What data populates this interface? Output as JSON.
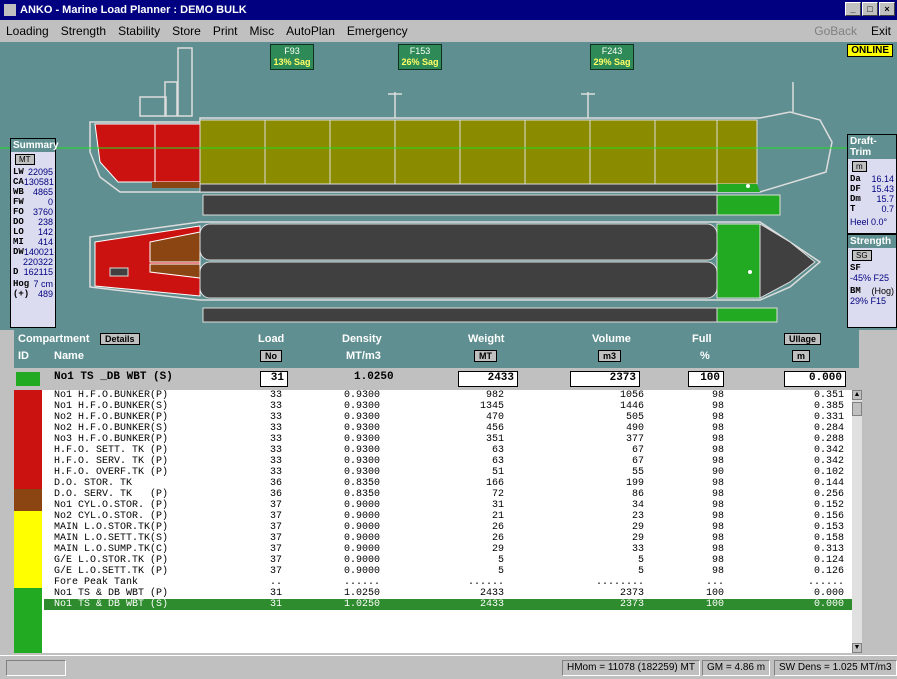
{
  "window": {
    "title": "ANKO - Marine Load Planner : DEMO BULK"
  },
  "menu": {
    "items": [
      "Loading",
      "Strength",
      "Stability",
      "Store",
      "Print",
      "Misc",
      "AutoPlan",
      "Emergency"
    ],
    "goback": "GoBack",
    "exit": "Exit"
  },
  "status_online": "ONLINE",
  "sag_frames": [
    {
      "frame": "F93",
      "value": "13% Sag"
    },
    {
      "frame": "F153",
      "value": "26% Sag"
    },
    {
      "frame": "F243",
      "value": "29% Sag"
    }
  ],
  "summary": {
    "title": "Summary",
    "unit": "MT",
    "rows": [
      [
        "LW",
        "22095"
      ],
      [
        "CA",
        "130581"
      ],
      [
        "WB",
        "4865"
      ],
      [
        "FW",
        "0"
      ],
      [
        "FO",
        "3760"
      ],
      [
        "DO",
        "238"
      ],
      [
        "LO",
        "142"
      ],
      [
        "MI",
        "414"
      ],
      [
        "DW",
        "140021"
      ],
      [
        "",
        "220322"
      ],
      [
        "D",
        "162115"
      ]
    ],
    "hog_label": "Hog",
    "hog_value": "7 cm",
    "hog_sign": "(+)",
    "hog_num": "489"
  },
  "draft_trim": {
    "title": "Draft-Trim",
    "unit": "m",
    "rows": [
      [
        "Da",
        "16.14"
      ],
      [
        "DF",
        "15.43"
      ],
      [
        "Dm",
        "15.7"
      ],
      [
        "T",
        "0.7"
      ]
    ],
    "heel": "Heel 0.0°"
  },
  "strength": {
    "title": "Strength",
    "unit": "SG",
    "sf_label": "SF",
    "sf_value": "-45% F25",
    "bm_label": "BM",
    "bm_mode": "(Hog)",
    "bm_value": "29% F15"
  },
  "table": {
    "headers": {
      "compartment": "Compartment",
      "details": "Details",
      "id": "ID",
      "name": "Name",
      "load": "Load",
      "load_unit": "No",
      "density": "Density",
      "density_unit": "MT/m3",
      "weight": "Weight",
      "weight_unit": "MT",
      "volume": "Volume",
      "volume_unit": "m3",
      "full": "Full",
      "full_unit": "%",
      "ullage": "Ullage",
      "ullage_unit": "m"
    },
    "selected": {
      "name": "No1 TS _DB WBT (S)",
      "load": "31",
      "density": "1.0250",
      "weight": "2433",
      "volume": "2373",
      "full": "100",
      "ullage": "0.000"
    },
    "rows": [
      [
        "No1 H.F.O.BUNKER(P)",
        "33",
        "0.9300",
        "982",
        "1056",
        "98",
        "0.351"
      ],
      [
        "No1 H.F.O.BUNKER(S)",
        "33",
        "0.9300",
        "1345",
        "1446",
        "98",
        "0.385"
      ],
      [
        "No2 H.F.O.BUNKER(P)",
        "33",
        "0.9300",
        "470",
        "505",
        "98",
        "0.331"
      ],
      [
        "No2 H.F.O.BUNKER(S)",
        "33",
        "0.9300",
        "456",
        "490",
        "98",
        "0.284"
      ],
      [
        "No3 H.F.O.BUNKER(P)",
        "33",
        "0.9300",
        "351",
        "377",
        "98",
        "0.288"
      ],
      [
        "H.F.O. SETT. TK (P)",
        "33",
        "0.9300",
        "63",
        "67",
        "98",
        "0.342"
      ],
      [
        "H.F.O. SERV. TK (P)",
        "33",
        "0.9300",
        "63",
        "67",
        "98",
        "0.342"
      ],
      [
        "H.F.O. OVERF.TK (P)",
        "33",
        "0.9300",
        "51",
        "55",
        "90",
        "0.102"
      ],
      [
        "D.O. STOR. TK",
        "36",
        "0.8350",
        "166",
        "199",
        "98",
        "0.144"
      ],
      [
        "D.O. SERV. TK   (P)",
        "36",
        "0.8350",
        "72",
        "86",
        "98",
        "0.256"
      ],
      [
        "No1 CYL.O.STOR. (P)",
        "37",
        "0.9000",
        "31",
        "34",
        "98",
        "0.152"
      ],
      [
        "No2 CYL.O.STOR. (P)",
        "37",
        "0.9000",
        "21",
        "23",
        "98",
        "0.156"
      ],
      [
        "MAIN L.O.STOR.TK(P)",
        "37",
        "0.9000",
        "26",
        "29",
        "98",
        "0.153"
      ],
      [
        "MAIN L.O.SETT.TK(S)",
        "37",
        "0.9000",
        "26",
        "29",
        "98",
        "0.158"
      ],
      [
        "MAIN L.O.SUMP.TK(C)",
        "37",
        "0.9000",
        "29",
        "33",
        "98",
        "0.313"
      ],
      [
        "G/E L.O.STOR.TK (P)",
        "37",
        "0.9000",
        "5",
        "5",
        "98",
        "0.124"
      ],
      [
        "G/E L.O.SETT.TK (P)",
        "37",
        "0.9000",
        "5",
        "5",
        "98",
        "0.126"
      ],
      [
        "Fore Peak Tank",
        "..",
        "......",
        "......",
        "........",
        "...",
        "......"
      ],
      [
        "No1 TS & DB WBT (P)",
        "31",
        "1.0250",
        "2433",
        "2373",
        "100",
        "0.000"
      ],
      [
        "No1 TS & DB WBT (S)",
        "31",
        "1.0250",
        "2433",
        "2373",
        "100",
        "0.000"
      ]
    ]
  },
  "statusbar": {
    "hmom": "HMom = 11078 (182259) MT",
    "gm": "GM = 4.86 m",
    "swdens": "SW Dens = 1.025 MT/m3"
  }
}
